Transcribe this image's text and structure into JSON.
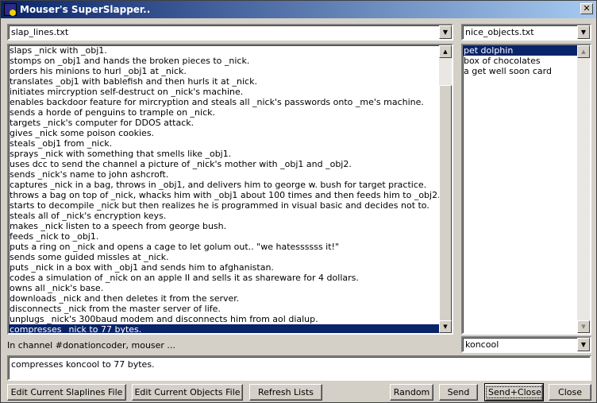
{
  "window": {
    "title": "Mouser's SuperSlapper..",
    "close": "✕"
  },
  "slap_file": {
    "value": "slap_lines.txt"
  },
  "slap_lines": [
    "slaps _nick with _obj1.",
    "stomps on _obj1 and hands the broken pieces to _nick.",
    "orders his minions to hurl _obj1 at _nick.",
    "translates _obj1 with bablefish and then hurls it at _nick.",
    "initiates mircryption self-destruct on _nick's machine.",
    "enables backdoor feature for mircryption and steals all _nick's passwords onto _me's machine.",
    "sends a horde of penguins to trample on _nick.",
    "targets _nick's computer for DDOS attack.",
    "gives _nick some poison cookies.",
    "steals _obj1 from _nick.",
    "sprays _nick with something that smells like _obj1.",
    "uses dcc to send the channel a picture of _nick's mother with _obj1 and _obj2.",
    "sends _nick's name to john ashcroft.",
    "captures _nick in a bag, throws in _obj1, and delivers him to george w. bush for target practice.",
    "throws a bag on top of _nick, whacks him with _obj1 about 100 times and then feeds him to _obj2.",
    "starts to decompile _nick but then realizes he is programmed in visual basic and decides not to.",
    "steals all of _nick's encryption keys.",
    "makes _nick listen to a speech from george bush.",
    "feeds _nick to _obj1.",
    "puts a ring on _nick and opens a cage to let golum out.. \"we hatessssss it!\"",
    "sends some guided missles at _nick.",
    "puts _nick in a box with _obj1 and sends him to afghanistan.",
    "codes a simulation of _nick on an apple II and sells it as shareware for 4 dollars.",
    "owns all _nick's base.",
    "downloads _nick and then deletes it from the server.",
    "disconnects _nick from the master server of life.",
    "unplugs _nick's 300baud modem and disconnects him from aol dialup.",
    "compresses _nick to 77 bytes."
  ],
  "slap_selected_index": 27,
  "objects_file": {
    "value": "nice_objects.txt"
  },
  "objects": [
    "pet dolphin",
    "box of chocolates",
    "a get well soon card"
  ],
  "objects_selected_index": 0,
  "channel_label": "In channel #donationcoder, mouser ...",
  "nick": {
    "value": "koncool"
  },
  "preview": "compresses koncool to 77 bytes.",
  "buttons": {
    "edit_slaplines": "Edit Current Slaplines File",
    "edit_objects": "Edit Current Objects File",
    "refresh": "Refresh Lists",
    "random": "Random",
    "send": "Send",
    "send_close": "Send+Close",
    "close": "Close"
  }
}
